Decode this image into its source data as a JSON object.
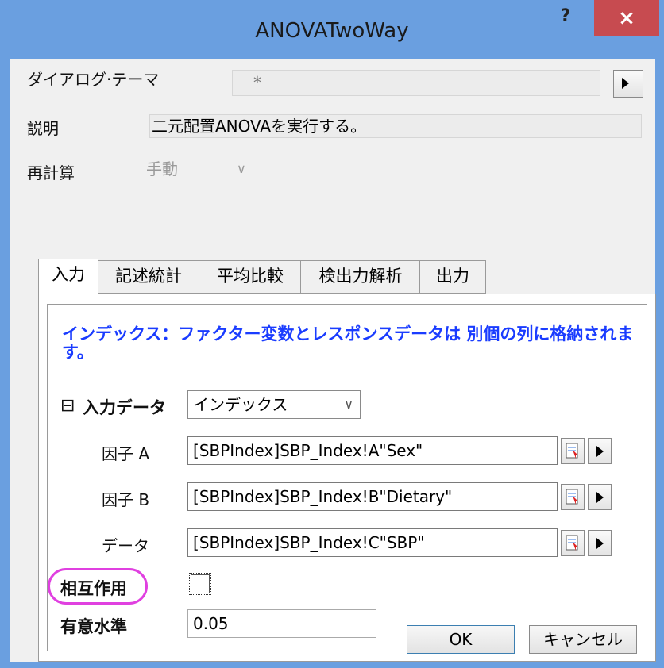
{
  "window": {
    "title": "ANOVATwoWay",
    "help_label": "?",
    "close_label": "×"
  },
  "theme": {
    "label": "ダイアログ·テーマ",
    "value": "*"
  },
  "description": {
    "label": "説明",
    "value": "二元配置ANOVAを実行する。"
  },
  "recalc": {
    "label": "再計算",
    "value": "手動"
  },
  "tabs": [
    {
      "label": "入力"
    },
    {
      "label": "記述統計"
    },
    {
      "label": "平均比較"
    },
    {
      "label": "検出力解析"
    },
    {
      "label": "出力"
    }
  ],
  "input_tab": {
    "description": "インデックス：ファクター変数とレスポンスデータは 別個の列に格納されます。",
    "input_data": {
      "toggle": "⊟",
      "label": "入力データ",
      "value": "インデックス"
    },
    "factor_a": {
      "label": "因子 A",
      "value": "[SBPIndex]SBP_Index!A\"Sex\""
    },
    "factor_b": {
      "label": "因子 B",
      "value": "[SBPIndex]SBP_Index!B\"Dietary\""
    },
    "data": {
      "label": "データ",
      "value": "[SBPIndex]SBP_Index!C\"SBP\""
    },
    "interaction": {
      "label": "相互作用",
      "checked": false
    },
    "significance": {
      "label": "有意水準",
      "value": "0.05"
    }
  },
  "buttons": {
    "ok": "OK",
    "cancel": "キャンセル"
  },
  "colors": {
    "titlebar": "#6a9fe0",
    "close": "#c74b50",
    "highlight_circle": "#e040e0",
    "description_text": "#1a3cff"
  }
}
